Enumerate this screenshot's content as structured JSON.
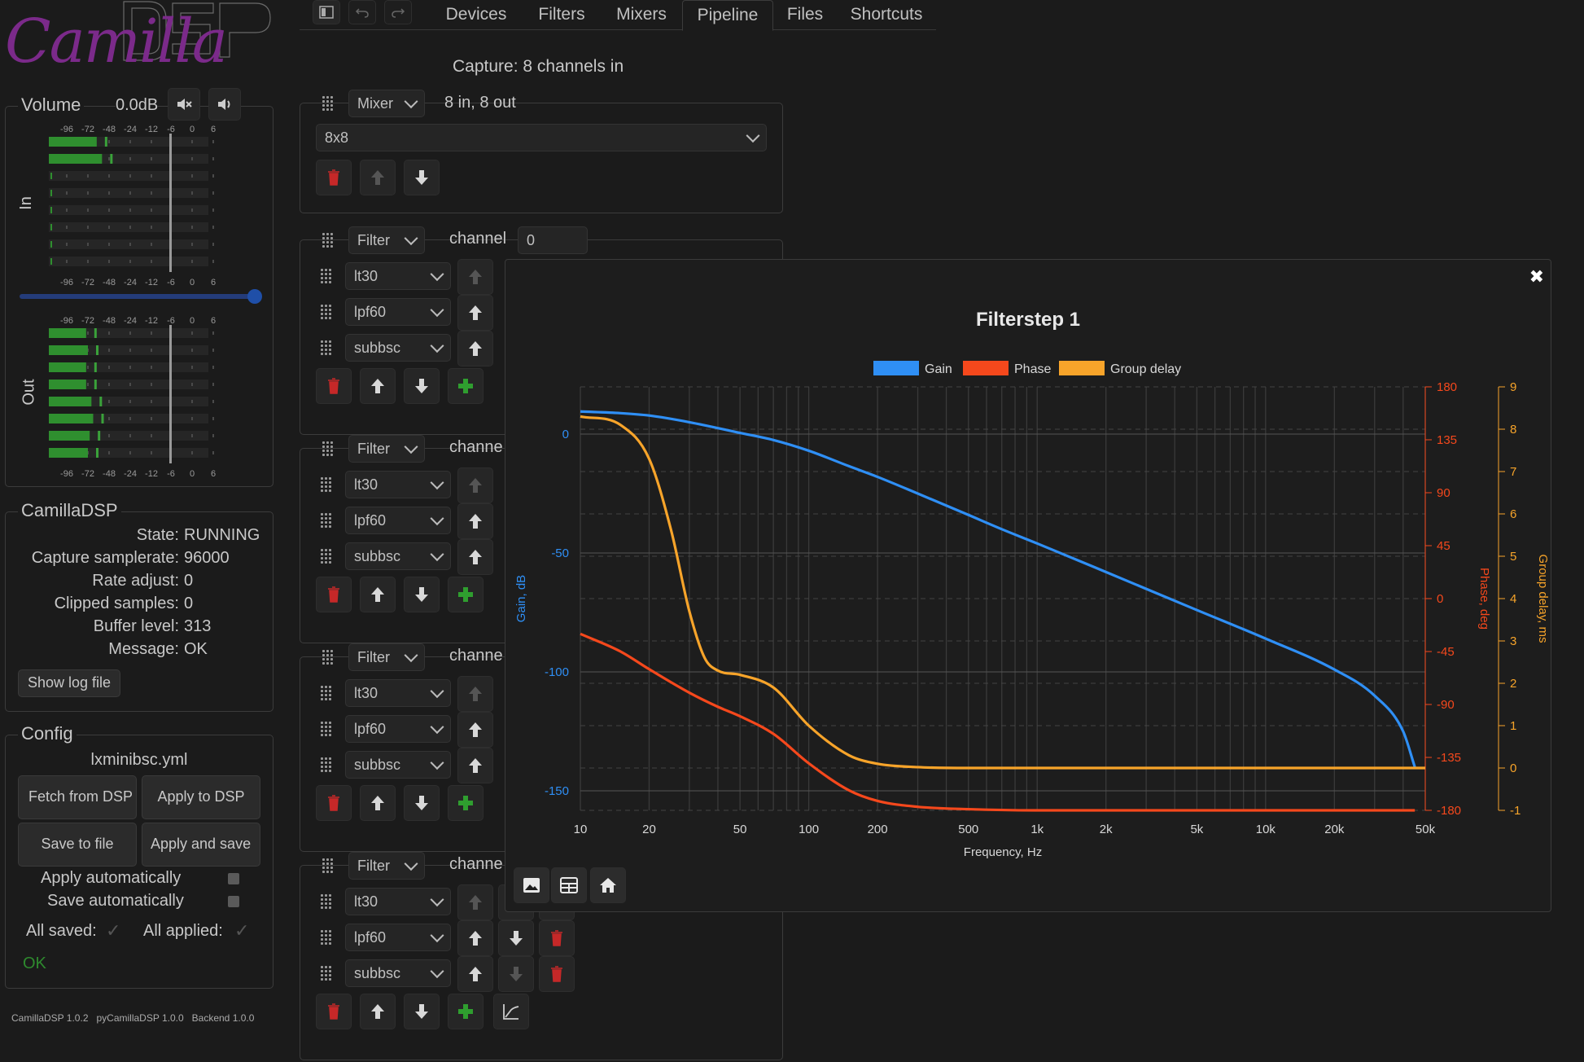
{
  "logo": {
    "script": "Camilla",
    "block": "DSP"
  },
  "toolbar": {
    "tabs": [
      "Devices",
      "Filters",
      "Mixers",
      "Pipeline",
      "Files",
      "Shortcuts"
    ],
    "active_tab": "Pipeline"
  },
  "volume": {
    "label": "Volume",
    "value": "0.0dB",
    "slider_fraction": 0.98,
    "scale": [
      "-96",
      "-72",
      "-48",
      "-24",
      "-12",
      "-6",
      "0",
      "6"
    ],
    "in_label": "In",
    "out_label": "Out",
    "in_levels_db": [
      -38,
      -32,
      -100,
      -100,
      -100,
      -100,
      -100,
      -100
    ],
    "out_levels_db": [
      -50,
      -48,
      -50,
      -50,
      -44,
      -42,
      -46,
      -48
    ]
  },
  "status": {
    "title": "CamillaDSP",
    "rows": [
      {
        "label": "State:",
        "value": "RUNNING"
      },
      {
        "label": "Capture samplerate:",
        "value": "96000"
      },
      {
        "label": "Rate adjust:",
        "value": "0"
      },
      {
        "label": "Clipped samples:",
        "value": "0"
      },
      {
        "label": "Buffer level:",
        "value": "313"
      },
      {
        "label": "Message:",
        "value": "OK"
      }
    ],
    "log_button": "Show log file"
  },
  "config": {
    "title": "Config",
    "filename": "lxminibsc.yml",
    "fetch": "Fetch from DSP",
    "apply": "Apply to DSP",
    "save": "Save to file",
    "apply_save": "Apply and save",
    "apply_auto": "Apply automatically",
    "save_auto": "Save automatically",
    "all_saved": "All saved:",
    "all_applied": "All applied:",
    "ok": "OK"
  },
  "versions": "CamillaDSP 1.0.2   pyCamillaDSP 1.0.0   Backend 1.0.0",
  "pipeline": {
    "capture": "Capture: 8 channels in",
    "mixer": {
      "type": "Mixer",
      "info": "8 in, 8 out",
      "name": "8x8"
    },
    "filter_type": "Filter",
    "channel_label": "channel",
    "channel_short": "channe",
    "channel_value": "0",
    "filters": [
      "lt30",
      "lpf60",
      "subbsc"
    ]
  },
  "plot": {
    "title": "Filterstep 1",
    "close": "✖",
    "legend": [
      {
        "name": "Gain",
        "color": "#2f8ff5"
      },
      {
        "name": "Phase",
        "color": "#f5481c"
      },
      {
        "name": "Group delay",
        "color": "#f7a42a"
      }
    ]
  },
  "chart_data": {
    "type": "line",
    "title": "Filterstep 1",
    "xlabel": "Frequency, Hz",
    "xscale": "log",
    "xlim": [
      10,
      50000
    ],
    "xticks": [
      "10",
      "20",
      "50",
      "100",
      "200",
      "500",
      "1k",
      "2k",
      "5k",
      "10k",
      "20k",
      "50k"
    ],
    "axes": {
      "gain": {
        "label": "Gain, dB",
        "ticks": [
          "0",
          "-50",
          "-100",
          "-150"
        ],
        "ylim": [
          -160,
          10
        ]
      },
      "phase": {
        "label": "Phase, deg",
        "ticks": [
          "180",
          "135",
          "90",
          "45",
          "0",
          "-45",
          "-90",
          "-135",
          "-180"
        ],
        "ylim": [
          -180,
          180
        ]
      },
      "delay": {
        "label": "Group delay, ms",
        "ticks": [
          "9",
          "8",
          "7",
          "6",
          "5",
          "4",
          "3",
          "2",
          "1",
          "0",
          "-1"
        ],
        "ylim": [
          -1,
          9
        ]
      }
    },
    "series": [
      {
        "name": "Gain",
        "axis": "gain",
        "x": [
          10,
          15,
          20,
          30,
          50,
          70,
          100,
          150,
          200,
          300,
          500,
          700,
          1000,
          2000,
          5000,
          10000,
          20000,
          30000,
          40000,
          45000
        ],
        "values": [
          9.5,
          8.8,
          7.8,
          5,
          0.5,
          -2.5,
          -7,
          -13.5,
          -18,
          -25,
          -34,
          -40,
          -46,
          -58,
          -74,
          -86,
          -99,
          -110,
          -125,
          -140
        ]
      },
      {
        "name": "Phase",
        "axis": "phase",
        "x": [
          10,
          15,
          20,
          30,
          40,
          50,
          70,
          100,
          150,
          200,
          300,
          500,
          1000,
          5000,
          45000
        ],
        "values": [
          -30,
          -45,
          -60,
          -80,
          -92,
          -100,
          -115,
          -140,
          -163,
          -172,
          -177,
          -179,
          -180,
          -180,
          -180
        ]
      },
      {
        "name": "Group delay",
        "axis": "delay",
        "x": [
          10,
          15,
          20,
          25,
          30,
          35,
          40,
          50,
          70,
          100,
          150,
          200,
          300,
          500,
          1000,
          50000
        ],
        "values": [
          8.3,
          8.1,
          7.3,
          5.6,
          3.7,
          2.6,
          2.3,
          2.2,
          1.9,
          1,
          0.3,
          0.1,
          0.02,
          0,
          0,
          0
        ]
      }
    ]
  }
}
